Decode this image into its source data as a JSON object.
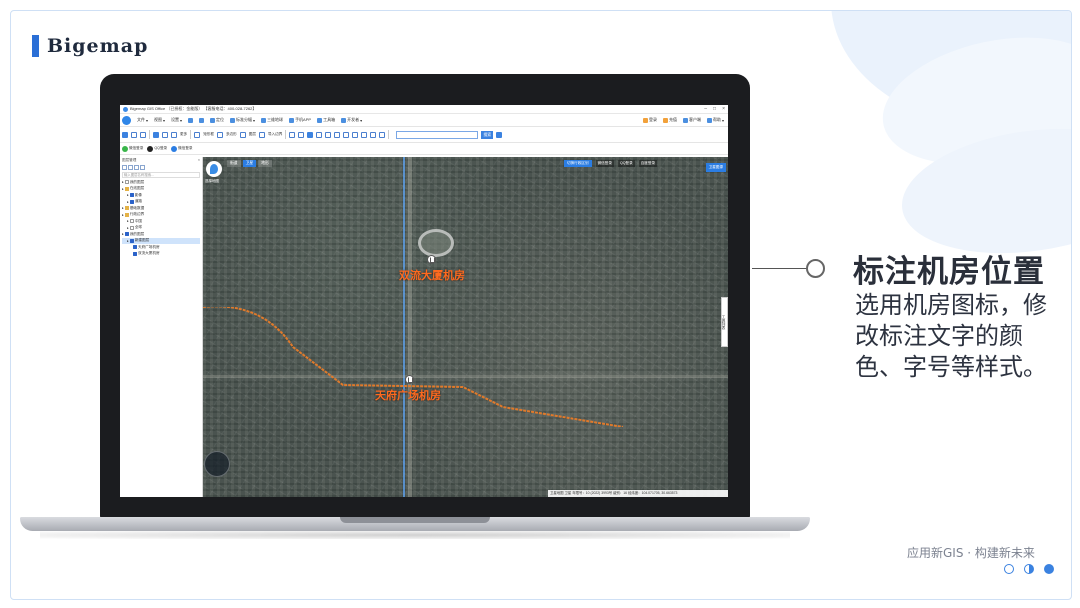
{
  "brand": {
    "name": "Bigemap"
  },
  "feature": {
    "title": "标注机房位置",
    "description": "选用机房图标，修改标注文字的颜色、字号等样式。"
  },
  "footer": {
    "slogan": "应用新GIS · 构建新未来",
    "pagination": [
      "empty",
      "half",
      "filled"
    ]
  },
  "app": {
    "window_title": "Bigemap GIS Office （已授权：金能版）   【客服电话：400-028-7262】",
    "menu": [
      "文件",
      "视图",
      "设置"
    ],
    "menu_tools": [
      "定位",
      "标准分幅",
      "三维地球",
      "手机APP",
      "工具箱",
      "开发者"
    ],
    "menu_right": [
      "登录",
      "充值",
      "客户端",
      "帮助"
    ],
    "toolbar": [
      "更多",
      "矩形框",
      "多边形",
      "图层",
      "导入边界"
    ],
    "search_button": "搜索",
    "logins": [
      "微信登录",
      "QQ登录",
      "微信登录"
    ],
    "sidebar": {
      "header": "图层管理",
      "search_placeholder": "输入图层名称搜索...",
      "tree": [
        {
          "label": "我的图层",
          "level": 0,
          "check": "empty"
        },
        {
          "label": "在线图层",
          "level": 0,
          "check": "folder"
        },
        {
          "label": "影像",
          "level": 1,
          "check": "on"
        },
        {
          "label": "道路",
          "level": 1,
          "check": "on"
        },
        {
          "label": "基础数据",
          "level": 0,
          "check": "folder"
        },
        {
          "label": "行政边界",
          "level": 0,
          "check": "folder"
        },
        {
          "label": "中国",
          "level": 1,
          "check": "empty"
        },
        {
          "label": "全球",
          "level": 1,
          "check": "empty"
        },
        {
          "label": "我的图层",
          "level": 0,
          "check": "on"
        },
        {
          "label": "新建图层",
          "level": 1,
          "check": "on",
          "selected": true
        },
        {
          "label": "天府广场机房",
          "level": 2,
          "check": "on"
        },
        {
          "label": "双流大厦机房",
          "level": 2,
          "check": "on"
        }
      ]
    },
    "map": {
      "tabs": [
        "街道",
        "卫星",
        "地形"
      ],
      "active_tab": "卫星",
      "logo_text": "选择地图",
      "top_button": "切换行政区划",
      "top_logins": [
        "微信登录",
        "QQ登录",
        "百度登录"
      ],
      "corner_button": "卫星图源",
      "side_tab": "工具列表",
      "labels": [
        "双流大厦机房",
        "天府广场机房"
      ],
      "status": "卫星地图 卫星  年限号：10 (2022) 3993号  级别：16  经纬度：104.071705, 30.663573"
    }
  }
}
